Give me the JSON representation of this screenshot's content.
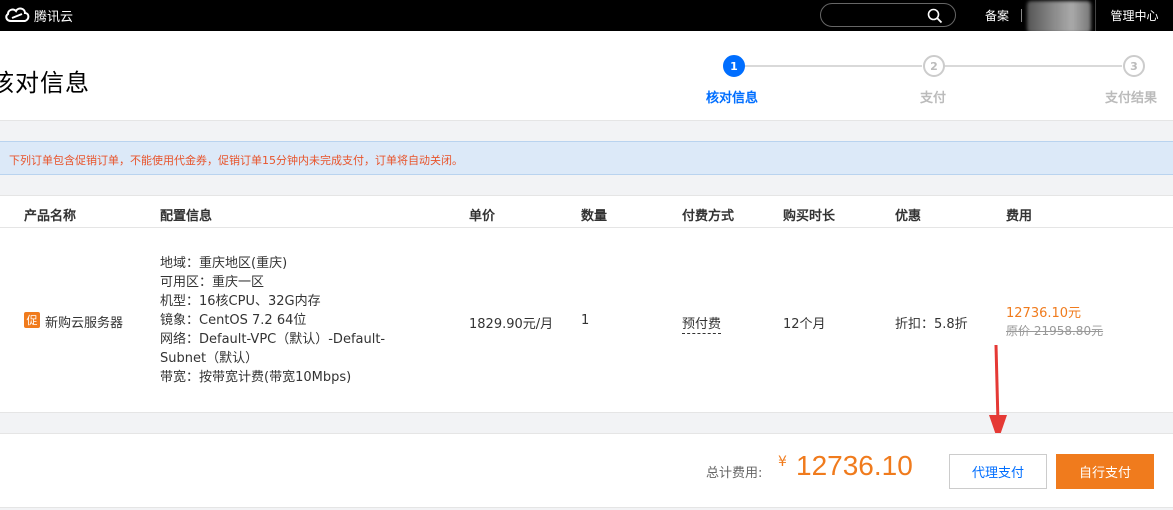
{
  "topbar": {
    "brand": "腾讯云",
    "search_placeholder": "",
    "beian": "备案",
    "console": "管理中心",
    "icons": {
      "logo": "cloud-logo-icon",
      "search": "search-icon"
    }
  },
  "header": {
    "title": "核对信息",
    "steps": [
      {
        "number": "1",
        "label": "核对信息",
        "state": "active"
      },
      {
        "number": "2",
        "label": "支付",
        "state": "todo"
      },
      {
        "number": "3",
        "label": "支付结果",
        "state": "todo"
      }
    ]
  },
  "notice": "下列订单包含促销订单，不能使用代金券，促销订单15分钟内未完成支付，订单将自动关闭。",
  "table": {
    "columns": [
      "产品名称",
      "配置信息",
      "单价",
      "数量",
      "付费方式",
      "购买时长",
      "优惠",
      "费用"
    ],
    "row": {
      "badge": "促",
      "product": "新购云服务器",
      "config": [
        "地域：重庆地区(重庆)",
        "可用区：重庆一区",
        "机型：16核CPU、32G内存",
        "镜象：CentOS 7.2 64位",
        "网络：Default-VPC（默认）-Default-Subnet（默认）",
        "带宽：按带宽计费(带宽10Mbps)"
      ],
      "unit_price": "1829.90元/月",
      "quantity": "1",
      "pay_method": "预付费",
      "duration": "12个月",
      "discount": "折扣：5.8折",
      "fee": "12736.10元",
      "original_fee": "原价 21958.80元"
    }
  },
  "footer": {
    "total_label": "总计费用:",
    "currency": "¥",
    "total": "12736.10",
    "proxy_pay": "代理支付",
    "self_pay": "自行支付"
  },
  "colors": {
    "accent": "#006eff",
    "orange": "#f07b1d",
    "notice_bg": "#dce9f8",
    "annotation": "#e53935"
  }
}
